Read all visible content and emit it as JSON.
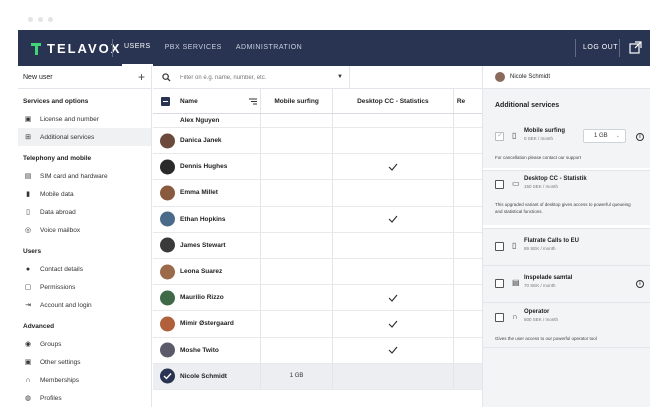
{
  "brand": {
    "name": "TELAVOX",
    "accent": "#3fd67a",
    "topbar_color": "#283452"
  },
  "nav": [
    {
      "label": "USERS",
      "active": true
    },
    {
      "label": "PBX SERVICES",
      "active": false
    },
    {
      "label": "ADMINISTRATION",
      "active": false
    }
  ],
  "logout_label": "LOG OUT",
  "sidebar": {
    "new_user": "New user",
    "sections": [
      {
        "title": "Services and options",
        "items": [
          {
            "label": "License and number",
            "icon": "id-card-icon",
            "active": false
          },
          {
            "label": "Additional services",
            "icon": "add-box-icon",
            "active": true
          }
        ]
      },
      {
        "title": "Telephony and mobile",
        "items": [
          {
            "label": "SIM card and hardware",
            "icon": "sim-card-icon",
            "active": false
          },
          {
            "label": "Mobile data",
            "icon": "signal-bars-icon",
            "active": false
          },
          {
            "label": "Data abroad",
            "icon": "phone-roaming-icon",
            "active": false
          },
          {
            "label": "Voice mailbox",
            "icon": "voicemail-icon",
            "active": false
          }
        ]
      },
      {
        "title": "Users",
        "items": [
          {
            "label": "Contact details",
            "icon": "person-icon",
            "active": false
          },
          {
            "label": "Permissions",
            "icon": "clipboard-icon",
            "active": false
          },
          {
            "label": "Account and login",
            "icon": "login-icon",
            "active": false
          }
        ]
      },
      {
        "title": "Advanced",
        "items": [
          {
            "label": "Groups",
            "icon": "groups-icon",
            "active": false
          },
          {
            "label": "Other settings",
            "icon": "settings-box-icon",
            "active": false
          },
          {
            "label": "Memberships",
            "icon": "headset-icon",
            "active": false
          },
          {
            "label": "Profiles",
            "icon": "profile-icon",
            "active": false
          }
        ]
      }
    ]
  },
  "search": {
    "placeholder": "Filter on e.g. name, number, etc."
  },
  "table": {
    "headers": {
      "name": "Name",
      "mobile": "Mobile surfing",
      "cc": "Desktop CC - Statistics",
      "re": "Re"
    },
    "rows": [
      {
        "name": "Alex Nguyen",
        "mobile": "",
        "cc": false,
        "avatar": "#7a5a48"
      },
      {
        "name": "Danica Janek",
        "mobile": "",
        "cc": false,
        "avatar": "#6b4a3c"
      },
      {
        "name": "Dennis Hughes",
        "mobile": "",
        "cc": true,
        "avatar": "#2a2a2a"
      },
      {
        "name": "Emma Millet",
        "mobile": "",
        "cc": false,
        "avatar": "#8a5a3e"
      },
      {
        "name": "Ethan Hopkins",
        "mobile": "",
        "cc": true,
        "avatar": "#4a6a8a"
      },
      {
        "name": "James Stewart",
        "mobile": "",
        "cc": false,
        "avatar": "#3a3a3a"
      },
      {
        "name": "Leona Suarez",
        "mobile": "",
        "cc": false,
        "avatar": "#9a6a4a"
      },
      {
        "name": "Maurilio Rizzo",
        "mobile": "",
        "cc": true,
        "avatar": "#3f6a48"
      },
      {
        "name": "Mimir Østergaard",
        "mobile": "",
        "cc": true,
        "avatar": "#b0603a"
      },
      {
        "name": "Moshe Twito",
        "mobile": "",
        "cc": true,
        "avatar": "#5a5a6a"
      },
      {
        "name": "Nicole Schmidt",
        "mobile": "1 GB",
        "cc": false,
        "avatar": "#283452",
        "selected": true
      }
    ]
  },
  "panel": {
    "user": "Nicole Schmidt",
    "title": "Additional services",
    "services": [
      {
        "name": "Mobile surfing",
        "price": "0 SEK / month",
        "checked": true,
        "icon": "phone-icon",
        "select": "1 GB",
        "info": true,
        "desc": "For cancellation please contact our support"
      },
      {
        "name": "Desktop CC - Statistik",
        "price": "150 SEK / month",
        "checked": false,
        "icon": "monitor-icon",
        "info": false,
        "desc": "This upgraded variant of desktop gives access to powerful queueing and statistical functions."
      },
      {
        "name": "Flatrate Calls to EU",
        "price": "89 SEK / month",
        "checked": false,
        "icon": "phone-icon",
        "info": false,
        "desc": ""
      },
      {
        "name": "Inspelade samtal",
        "price": "70 SEK / month",
        "checked": false,
        "icon": "keyboard-icon",
        "info": true,
        "desc": ""
      },
      {
        "name": "Operator",
        "price": "500 SEK / month",
        "checked": false,
        "icon": "headset-icon",
        "info": false,
        "desc": "Gives the user access to our powerful operator tool"
      }
    ]
  }
}
